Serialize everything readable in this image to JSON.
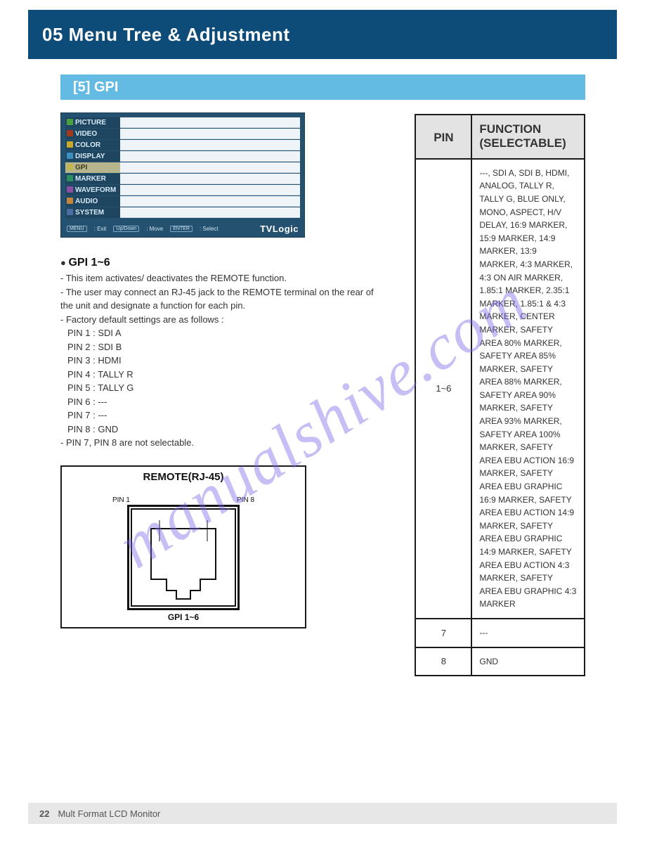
{
  "header": {
    "title": "05 Menu Tree & Adjustment"
  },
  "subheader": "[5] GPI",
  "menu": {
    "items": [
      {
        "label": "PICTURE",
        "value": ""
      },
      {
        "label": "VIDEO",
        "value": ""
      },
      {
        "label": "COLOR",
        "value": ""
      },
      {
        "label": "DISPLAY",
        "value": ""
      },
      {
        "label": "GPI",
        "value": "",
        "active": true
      },
      {
        "label": "MARKER",
        "value": ""
      },
      {
        "label": "WAVEFORM",
        "value": ""
      },
      {
        "label": "AUDIO",
        "value": ""
      },
      {
        "label": "SYSTEM",
        "value": ""
      }
    ],
    "footer": {
      "menu": "MENU",
      "exit": ": Exit",
      "updown": "Up/Down",
      "move": ": Move",
      "enter": "ENTER",
      "select": ": Select",
      "logo": "TVLogic"
    }
  },
  "body": {
    "item1": {
      "bullet": "●",
      "title": "GPI 1~6",
      "line1": "- This item activates/ deactivates the REMOTE function.",
      "line2": "- The user may connect an RJ-45 jack to the REMOTE terminal on the rear of the unit and designate a function for each pin.",
      "line3": "- Factory default settings are as follows :"
    },
    "pins": {
      "p1": "PIN 1 : SDI A",
      "p2": "PIN 2 : SDI B",
      "p3": "PIN 3 : HDMI",
      "p4": "PIN 4 : TALLY R",
      "p5": "PIN 5 : TALLY G",
      "p6": "PIN 6 : ---",
      "p7": "PIN 7 : ---",
      "p8": "PIN 8 : GND"
    },
    "item2": {
      "line": "- PIN 7, PIN 8 are not selectable."
    }
  },
  "table": {
    "head": {
      "pin": "PIN",
      "func": "FUNCTION (SELECTABLE)"
    },
    "rows": [
      {
        "pin": "1~6",
        "func": "---, SDI A, SDI B, HDMI, ANALOG, TALLY R, TALLY G, BLUE ONLY, MONO, ASPECT, H/V DELAY, 16:9 MARKER, 15:9 MARKER, 14:9 MARKER, 13:9 MARKER, 4:3 MARKER, 4:3 ON AIR MARKER, 1.85:1 MARKER, 2.35:1 MARKER, 1.85:1 & 4:3 MARKER, CENTER MARKER, SAFETY AREA 80% MARKER, SAFETY AREA 85% MARKER, SAFETY AREA 88% MARKER, SAFETY AREA 90% MARKER, SAFETY AREA 93% MARKER, SAFETY AREA 100% MARKER, SAFETY AREA EBU ACTION 16:9 MARKER, SAFETY AREA EBU GRAPHIC 16:9 MARKER, SAFETY AREA EBU ACTION 14:9 MARKER, SAFETY AREA EBU GRAPHIC 14:9 MARKER, SAFETY AREA EBU ACTION 4:3 MARKER, SAFETY AREA EBU GRAPHIC 4:3 MARKER"
      },
      {
        "pin": "7",
        "func": "---"
      },
      {
        "pin": "8",
        "func": "GND"
      }
    ]
  },
  "connector": {
    "label": "REMOTE(RJ-45)",
    "left": "PIN 1",
    "right": "PIN 8",
    "caption": "GPI 1~6"
  },
  "watermark": "manualshive.com",
  "footer": {
    "page": "22",
    "text": "Mult Format LCD Monitor"
  }
}
